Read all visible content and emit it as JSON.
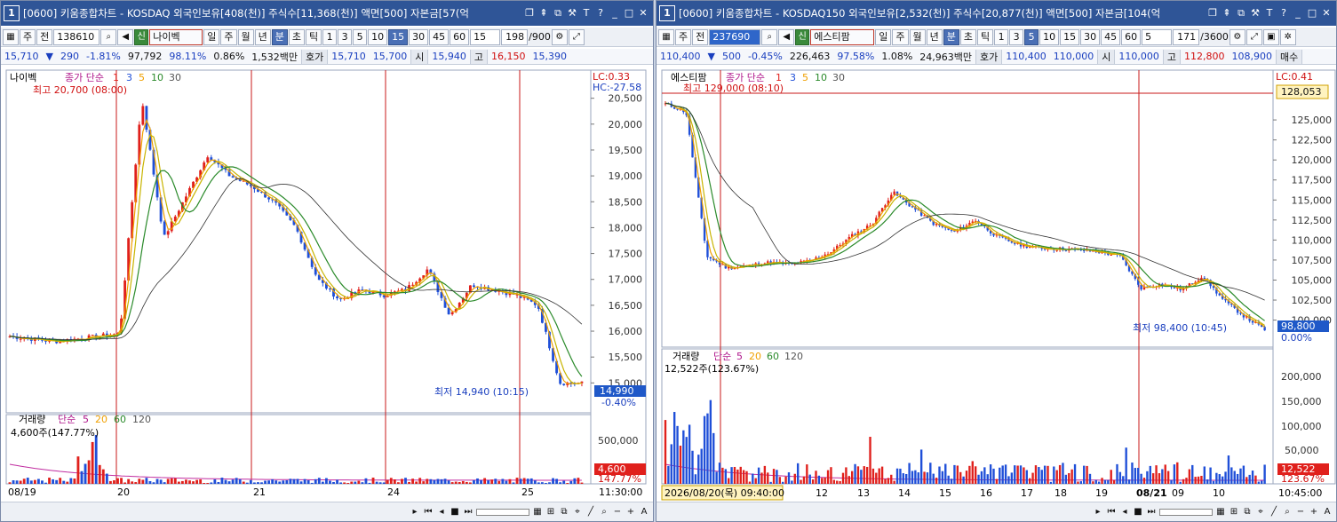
{
  "left": {
    "title": "[0600] 키움종합차트 - KOSDAQ 외국인보유[408(천)] 주식수[11,368(천)] 액면[500] 자본금[57(억",
    "window_num": "1",
    "toolbar": {
      "type_btn": "주",
      "prev_btn": "전",
      "code": "138610",
      "name": "나이벡",
      "new_badge": "신",
      "periods": [
        "일",
        "주",
        "월",
        "년",
        "분",
        "초",
        "틱"
      ],
      "active_period": "분",
      "intervals": [
        "1",
        "3",
        "5",
        "10",
        "15",
        "30",
        "45",
        "60"
      ],
      "active_interval": "15",
      "interval_select": "15",
      "count": "198",
      "count_total": "/900"
    },
    "quote": {
      "price": "15,710",
      "change": "290",
      "change_pct": "-1.81%",
      "volume": "97,792",
      "vol_ratio": "98.11%",
      "turnover": "0.86%",
      "amount": "1,532백만",
      "ask_label": "호가",
      "ask1": "15,710",
      "ask2": "15,700",
      "open_label": "시",
      "open": "15,940",
      "high_label": "고",
      "high": "16,150",
      "low": "15,390"
    },
    "chart": {
      "legend_name": "나이벡",
      "legend_ma": "종가 단순",
      "ma_periods": [
        "1",
        "3",
        "5",
        "10",
        "30"
      ],
      "high_label": "최고 20,700 (08:00)",
      "low_label": "최저 14,940 (10:15)",
      "lc_label": "LC:0.33",
      "hc_label": "HC:-27.58",
      "price_axis": [
        "20,500",
        "20,000",
        "19,500",
        "19,000",
        "18,500",
        "18,000",
        "17,500",
        "17,000",
        "16,500",
        "16,000",
        "15,500",
        "15,000"
      ],
      "current_price": "14,990",
      "current_pct": "-0.40%",
      "volume_legend": "거래량",
      "volume_ma": "단순",
      "volume_ma_periods": [
        "5",
        "20",
        "60",
        "120"
      ],
      "volume_value": "4,600주(147.77%)",
      "volume_axis": [
        "500,000"
      ],
      "volume_current": "4,600",
      "volume_pct": "147.77%",
      "date_labels": [
        "08/19",
        "20",
        "21",
        "24",
        "25"
      ],
      "time_label": "11:30:00"
    }
  },
  "right": {
    "title": "[0600] 키움종합차트 - KOSDAQ150 외국인보유[2,532(천)] 주식수[20,877(천)] 액면[500] 자본금[104(억",
    "window_num": "1",
    "toolbar": {
      "type_btn": "주",
      "prev_btn": "전",
      "code": "237690",
      "name": "에스티팜",
      "new_badge": "신",
      "periods": [
        "일",
        "주",
        "월",
        "년",
        "분",
        "초",
        "틱"
      ],
      "active_period": "분",
      "intervals": [
        "1",
        "3",
        "5",
        "10",
        "15",
        "30",
        "45",
        "60"
      ],
      "active_interval": "5",
      "interval_select": "5",
      "count": "171",
      "count_total": "/3600"
    },
    "quote": {
      "price": "110,400",
      "change": "500",
      "change_pct": "-0.45%",
      "volume": "226,463",
      "vol_ratio": "97.58%",
      "turnover": "1.08%",
      "amount": "24,963백만",
      "ask_label": "호가",
      "ask1": "110,400",
      "ask2": "110,000",
      "open_label": "시",
      "open": "110,000",
      "high_label": "고",
      "high": "112,800",
      "low": "108,900",
      "trade_label": "매수"
    },
    "chart": {
      "legend_name": "에스티팜",
      "legend_ma": "종가 단순",
      "ma_periods": [
        "1",
        "3",
        "5",
        "10",
        "30"
      ],
      "high_label": "최고 129,000 (08:10)",
      "low_label": "최저 98,400 (10:45)",
      "lc_label": "LC:0.41",
      "high_box": "128,053",
      "price_axis": [
        "125,000",
        "122,500",
        "120,000",
        "117,500",
        "115,000",
        "112,500",
        "110,000",
        "107,500",
        "105,000",
        "102,500",
        "100,000"
      ],
      "current_price": "98,800",
      "current_pct": "0.00%",
      "volume_legend": "거래량",
      "volume_ma": "단순",
      "volume_ma_periods": [
        "5",
        "20",
        "60",
        "120"
      ],
      "volume_value": "12,522주(123.67%)",
      "volume_axis": [
        "200,000",
        "150,000",
        "100,000",
        "50,000"
      ],
      "volume_current": "12,522",
      "volume_pct": "123.67%",
      "date_labels": [
        "2026/08/20(목) 09:40:00",
        "12",
        "13",
        "14",
        "15",
        "16",
        "17",
        "18",
        "19",
        "08/21",
        "09",
        "10"
      ],
      "time_label": "10:45:00"
    }
  },
  "colors": {
    "title_bg": "#2f5597",
    "up": "#e0201c",
    "down": "#1f4fd8",
    "ma3": "#f0a000",
    "ma5": "#c8b400",
    "ma10": "#2a8a2a",
    "ma30": "#333333",
    "vline": "#c81818"
  },
  "chart_data": [
    {
      "type": "line",
      "title": "나이벡",
      "series": [
        {
          "name": "종가",
          "x": [
            "08/19",
            "20",
            "21",
            "24",
            "25"
          ],
          "values": [
            15900,
            20500,
            18300,
            16700,
            14990
          ]
        }
      ],
      "ylim": [
        14800,
        20700
      ],
      "volume_series": [
        {
          "name": "거래량",
          "last": 4600
        }
      ]
    },
    {
      "type": "line",
      "title": "에스티팜",
      "series": [
        {
          "name": "종가",
          "x": [
            "09:40",
            "12",
            "13",
            "14",
            "15",
            "16",
            "17",
            "18",
            "19",
            "08/21",
            "09",
            "10"
          ],
          "values": [
            127000,
            107000,
            108000,
            115500,
            111000,
            110000,
            109000,
            108800,
            108500,
            104500,
            105500,
            98800
          ]
        }
      ],
      "ylim": [
        98400,
        129000
      ],
      "volume_series": [
        {
          "name": "거래량",
          "last": 12522
        }
      ]
    }
  ]
}
